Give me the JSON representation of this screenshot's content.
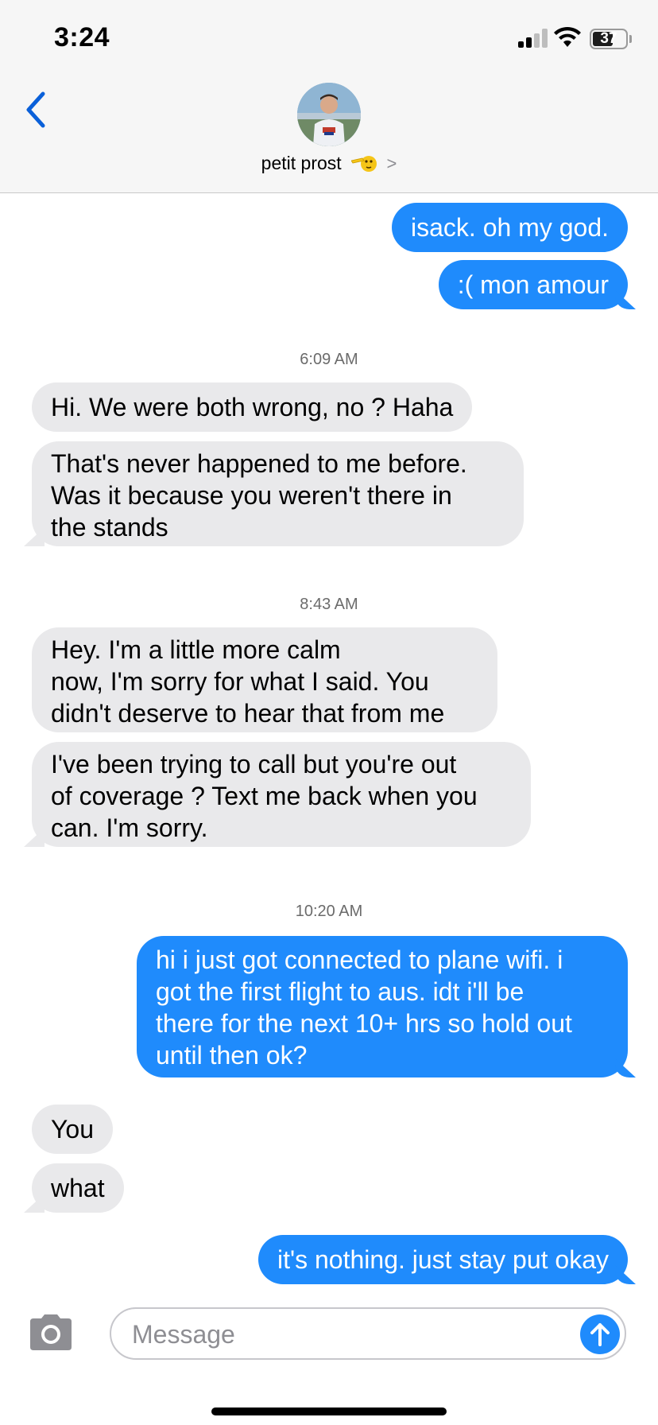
{
  "status_bar": {
    "time": "3:24",
    "battery": "37",
    "battery_level": 0.37
  },
  "header": {
    "contact_name": "petit prost",
    "contact_emoji": "saluting-face-emoji"
  },
  "messages": [
    {
      "direction": "outgoing",
      "text": "isack. oh my god."
    },
    {
      "direction": "outgoing",
      "text": ":( mon amour"
    },
    {
      "type": "timestamp",
      "text": "6:09 AM"
    },
    {
      "direction": "incoming",
      "text": "Hi. We were both wrong, no ? Haha"
    },
    {
      "direction": "incoming",
      "text": "That's never happened to me before.\nWas it because you weren't there in\nthe stands"
    },
    {
      "type": "timestamp",
      "text": "8:43 AM"
    },
    {
      "direction": "incoming",
      "text": "Hey. I'm a little more calm\nnow, I'm sorry for what I said. You\ndidn't deserve to hear that from me"
    },
    {
      "direction": "incoming",
      "text": "I've been trying to call but you're out\nof coverage ? Text me back when you\ncan. I'm sorry."
    },
    {
      "type": "timestamp",
      "text": "10:20 AM"
    },
    {
      "direction": "outgoing",
      "text": "hi i just got connected to plane wifi. i\ngot the first flight to aus. idt i'll be\nthere for the next 10+ hrs so hold out\nuntil then ok?"
    },
    {
      "direction": "incoming",
      "text": "You"
    },
    {
      "direction": "incoming",
      "text": "what"
    },
    {
      "direction": "outgoing",
      "text": "it's nothing. just stay put okay"
    }
  ],
  "input": {
    "placeholder": "Message"
  },
  "colors": {
    "outgoing_bubble": "#1f8bfc",
    "incoming_bubble": "#e9e9eb",
    "accent": "#0a60d9"
  }
}
